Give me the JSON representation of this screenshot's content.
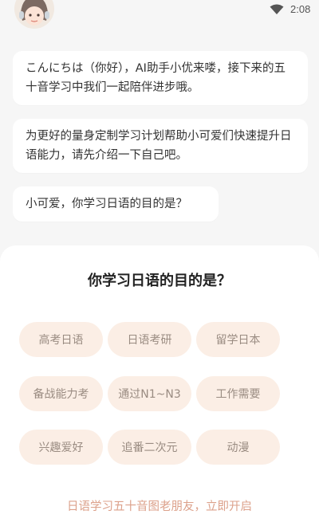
{
  "status_bar": {
    "time": "2:08",
    "wifi_icon": "wifi-icon"
  },
  "chat": {
    "messages": [
      "こんにちは（你好），AI助手小优来喽，接下来的五十音学习中我们一起陪伴进步哦。",
      "为更好的量身定制学习计划帮助小可爱们快速提升日语能力，请先介绍一下自己吧。",
      "小可爱，你学习日语的目的是？"
    ]
  },
  "sheet": {
    "title": "你学习日语的目的是？",
    "options": [
      "高考日语",
      "日语考研",
      "留学日本",
      "备战能力考",
      "通过N1~N3",
      "工作需要",
      "兴趣爱好",
      "追番二次元",
      "动漫"
    ],
    "cta": "日语学习五十音图老朋友，立即开启"
  },
  "colors": {
    "background": "#f6f6f6",
    "option_bg": "#fbeee5",
    "option_text": "#9a8c82",
    "cta_text": "#dca18b"
  }
}
